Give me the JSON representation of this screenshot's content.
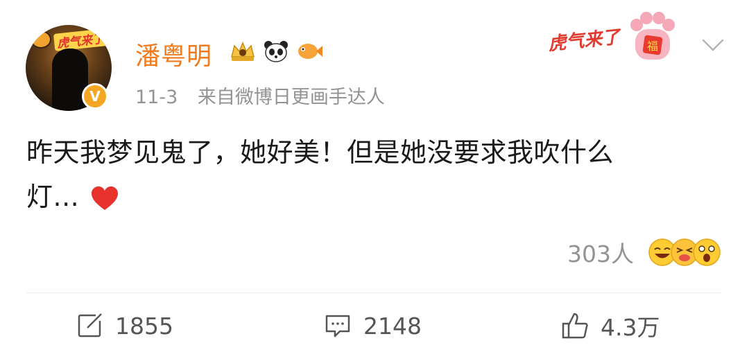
{
  "post": {
    "author": {
      "name": "潘粤明",
      "verified_badge": "V",
      "avatar_overlay_text": "虎气来了",
      "badges": [
        "crown-badge-icon",
        "panda-icon",
        "fish-icon"
      ]
    },
    "time": "11-3",
    "source": "来自微博日更画手达人",
    "event_badge_text": "虎气来了",
    "event_badge_glyph": "福",
    "content_line1": "昨天我梦见鬼了，她好美！但是她没要求我吹什么",
    "content_line2": "灯...",
    "reaction_count": "303人",
    "reaction_emojis": [
      "laugh-emoji-icon",
      "tease-emoji-icon",
      "shock-emoji-icon"
    ]
  },
  "actions": {
    "repost_count": "1855",
    "comment_count": "2148",
    "like_count": "4.3万"
  },
  "colors": {
    "username": "#f07a1c",
    "meta": "#939393",
    "text": "#1a1a1a",
    "heart": "#e8322d"
  }
}
